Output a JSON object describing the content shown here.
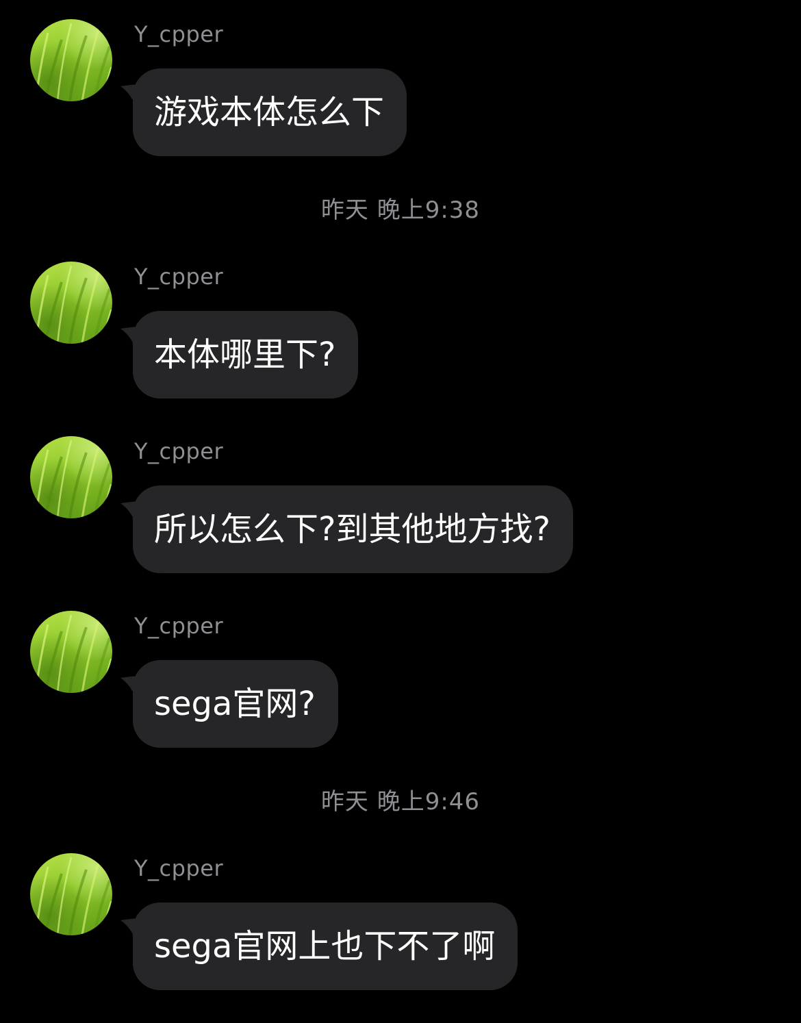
{
  "conversation": {
    "messages": [
      {
        "sender": "Y_cpper",
        "text": "游戏本体怎么下"
      },
      {
        "sender": "Y_cpper",
        "text": "本体哪里下?"
      },
      {
        "sender": "Y_cpper",
        "text": "所以怎么下?到其他地方找?"
      },
      {
        "sender": "Y_cpper",
        "text": "sega官网?"
      },
      {
        "sender": "Y_cpper",
        "text": "sega官网上也下不了啊"
      }
    ],
    "timestamps": [
      {
        "text": "昨天 晚上9:38"
      },
      {
        "text": "昨天 晚上9:46"
      }
    ]
  },
  "colors": {
    "background": "#000000",
    "bubble": "#262628",
    "message_text": "#ffffff",
    "secondary_text": "#8f8f94"
  },
  "icons": {
    "avatar": "green-grass-avatar-icon"
  }
}
